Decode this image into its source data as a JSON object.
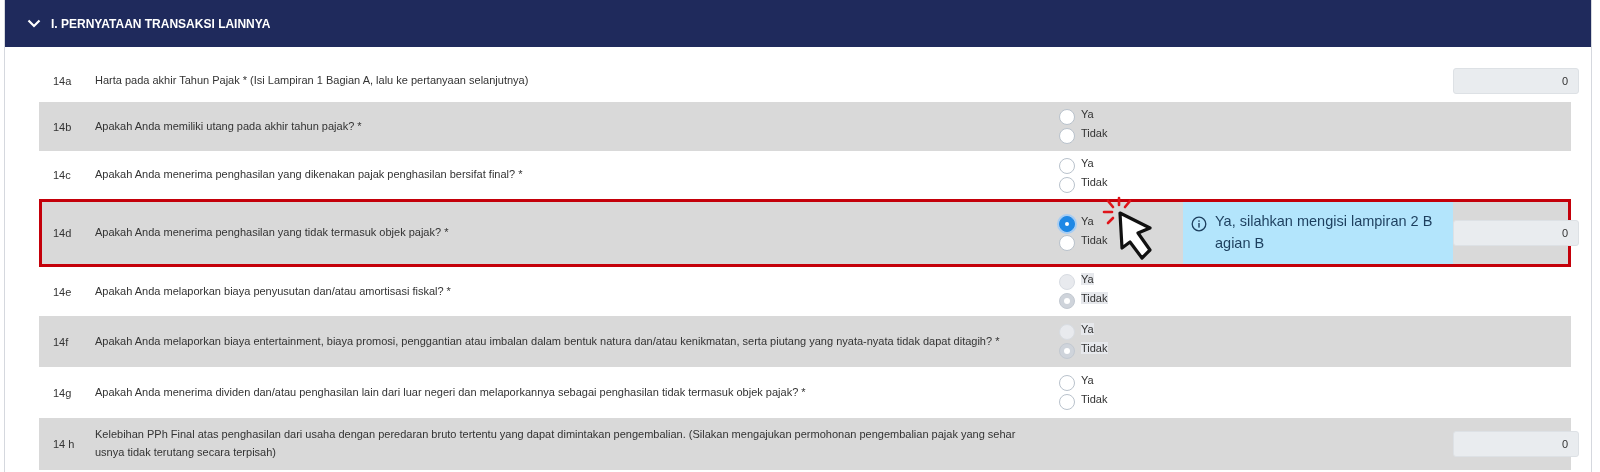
{
  "section": {
    "title": "I. PERNYATAAN TRANSAKSI LAINNYA",
    "expanded": true
  },
  "rows": [
    {
      "number": "14a",
      "kind": "amount",
      "question": "Harta pada akhir Tahun Pajak * (Isi Lampiran 1 Bagian A, lalu ke pertanyaan selanjutnya)",
      "amount": "0",
      "highlighted": false
    },
    {
      "number": "14b",
      "kind": "yesno",
      "question": "Apakah Anda memiliki utang pada akhir tahun pajak? *",
      "options": [
        {
          "label": "Ya",
          "selected": false,
          "disabled": false
        },
        {
          "label": "Tidak",
          "selected": false,
          "disabled": false
        }
      ],
      "highlighted": false
    },
    {
      "number": "14c",
      "kind": "yesno",
      "question": "Apakah Anda menerima penghasilan yang dikenakan pajak penghasilan bersifat final? *",
      "options": [
        {
          "label": "Ya",
          "selected": false,
          "disabled": false
        },
        {
          "label": "Tidak",
          "selected": false,
          "disabled": false
        }
      ],
      "highlighted": false
    },
    {
      "number": "14d",
      "kind": "yesno",
      "question": "Apakah Anda menerima penghasilan yang tidak termasuk objek pajak? *",
      "options": [
        {
          "label": "Ya",
          "selected": true,
          "disabled": false
        },
        {
          "label": "Tidak",
          "selected": false,
          "disabled": false
        }
      ],
      "tooltip": "Ya, silahkan mengisi lampiran 2 B agian B",
      "amount": "0",
      "highlighted": true
    },
    {
      "number": "14e",
      "kind": "yesno",
      "question": "Apakah Anda melaporkan biaya penyusutan dan/atau amortisasi fiskal? *",
      "options": [
        {
          "label": "Ya",
          "selected": false,
          "disabled": true
        },
        {
          "label": "Tidak",
          "selected": true,
          "disabled": true
        }
      ],
      "highlighted": false
    },
    {
      "number": "14f",
      "kind": "yesno",
      "question": "Apakah Anda melaporkan biaya entertainment, biaya promosi, penggantian atau imbalan dalam bentuk natura dan/atau kenikmatan, serta piutang yang nyata-nyata tidak dapat ditagih? *",
      "options": [
        {
          "label": "Ya",
          "selected": false,
          "disabled": true
        },
        {
          "label": "Tidak",
          "selected": true,
          "disabled": true
        }
      ],
      "highlighted": false
    },
    {
      "number": "14g",
      "kind": "yesno",
      "question": "Apakah Anda menerima dividen dan/atau penghasilan lain dari luar negeri dan melaporkannya sebagai penghasilan tidak termasuk objek pajak? *",
      "options": [
        {
          "label": "Ya",
          "selected": false,
          "disabled": false
        },
        {
          "label": "Tidak",
          "selected": false,
          "disabled": false
        }
      ],
      "highlighted": false
    },
    {
      "number": "14 h",
      "kind": "amount",
      "question": "Kelebihan PPh Final atas penghasilan dari usaha dengan peredaran bruto tertentu yang dapat dimintakan pengembalian. (Silakan mengajukan permohonan pengembalian pajak yang sehar usnya tidak terutang secara terpisah)",
      "amount": "0",
      "highlighted": false
    }
  ]
}
